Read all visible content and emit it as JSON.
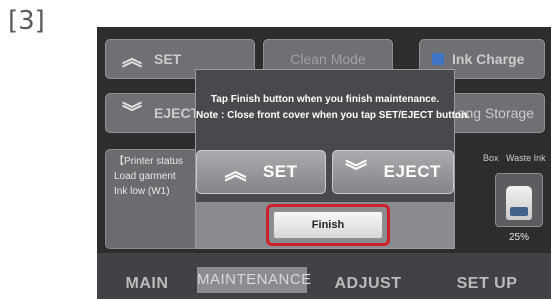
{
  "step_label": "[3]",
  "background": {
    "buttons": {
      "set": "SET",
      "eject": "EJECT",
      "print": "Clean Mode",
      "ink": "Ink Charge",
      "storage": "Long Storage"
    },
    "status": {
      "title": "【Printer status",
      "line1": "Load garment",
      "line2": "Ink low (W1)"
    },
    "box_label": "Box",
    "waste_label": "Waste Ink",
    "waste_percent": "25%",
    "tabs": [
      "MAIN",
      "MAINTENANCE",
      "ADJUST",
      "SET UP"
    ],
    "active_tab": "MAINTENANCE"
  },
  "dialog": {
    "line1": "Tap Finish button when you finish maintenance.",
    "line2": "Note : Close front cover when you tap SET/EJECT button.",
    "set_label": "SET",
    "eject_label": "EJECT",
    "finish_label": "Finish"
  },
  "colors": {
    "highlight": "#d0202a",
    "ink_indicator": "#3f73c4"
  }
}
